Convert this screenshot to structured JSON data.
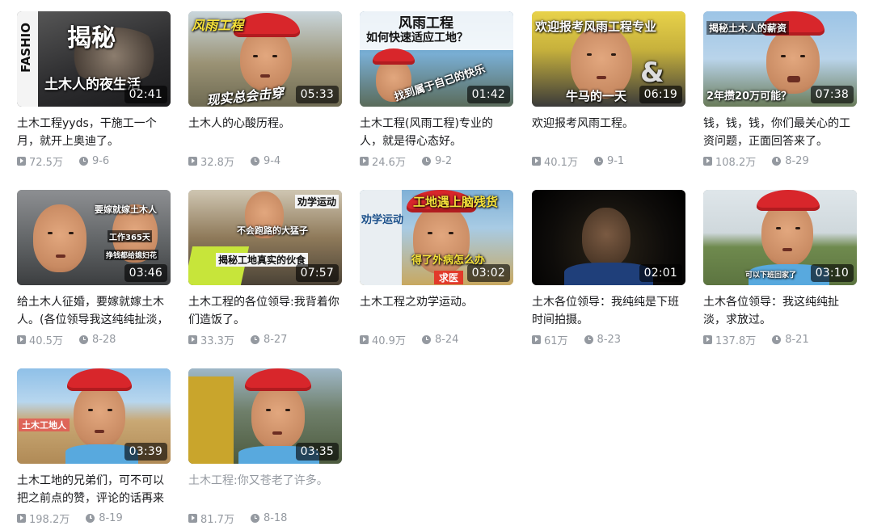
{
  "colors": {
    "text": "#18191c",
    "muted": "#9499a0",
    "duration_bg": "#000000"
  },
  "videos": [
    {
      "duration": "02:41",
      "title": "土木工程yyds，干施工一个月，就开上奥迪了。",
      "views": "72.5万",
      "date": "9-6",
      "overlay": [
        "揭秘",
        "土木人的夜生活",
        "FASHIO"
      ]
    },
    {
      "duration": "05:33",
      "title": "土木人的心酸历程。",
      "views": "32.8万",
      "date": "9-4",
      "overlay": [
        "风雨工程",
        "现实总会击穿"
      ]
    },
    {
      "duration": "01:42",
      "title": "土木工程(风雨工程)专业的人，就是得心态好。",
      "views": "24.6万",
      "date": "9-2",
      "overlay": [
        "风雨工程",
        "如何快速适应工地？",
        "找到属于自己的快乐"
      ]
    },
    {
      "duration": "06:19",
      "title": "欢迎报考风雨工程。",
      "views": "40.1万",
      "date": "9-1",
      "overlay": [
        "欢迎报考风雨工程专业",
        "牛马的一天",
        "&"
      ]
    },
    {
      "duration": "07:38",
      "title": "钱，钱，钱，你们最关心的工资问题，正面回答来了。",
      "views": "108.2万",
      "date": "8-29",
      "overlay": [
        "揭秘土木人的薪资",
        "2年攒20万可能？"
      ]
    },
    {
      "duration": "03:46",
      "title": "给土木人征婚，要嫁就嫁土木人。(各位领导我这纯纯扯淡，",
      "views": "40.5万",
      "date": "8-28",
      "overlay": [
        "要嫁就嫁土木人",
        "工作365天",
        "挣钱都给媳妇花"
      ]
    },
    {
      "duration": "07:57",
      "title": "土木工程的各位领导:我背着你们造饭了。",
      "views": "33.3万",
      "date": "8-27",
      "overlay": [
        "劝学运动",
        "不会跑路的大猛子",
        "揭秘工地真实的伙食"
      ]
    },
    {
      "duration": "03:02",
      "title": "土木工程之劝学运动。",
      "views": "40.9万",
      "date": "8-24",
      "overlay": [
        "工地遇上脑残货",
        "劝学运动",
        "得了外病怎么办",
        "求医"
      ]
    },
    {
      "duration": "02:01",
      "title": "土木各位领导：我纯纯是下班时间拍摄。",
      "views": "61万",
      "date": "8-23",
      "overlay": []
    },
    {
      "duration": "03:10",
      "title": "土木各位领导：我这纯纯扯淡，求放过。",
      "views": "137.8万",
      "date": "8-21",
      "overlay": [
        "可以下班回家了"
      ]
    },
    {
      "duration": "03:39",
      "title": "土木工地的兄弟们，可不可以把之前点的赞，评论的话再来",
      "views": "198.2万",
      "date": "8-19",
      "overlay": [
        "土木工地人"
      ]
    },
    {
      "duration": "03:35",
      "title": "土木工程:你又苍老了许多。",
      "views": "81.7万",
      "date": "8-18",
      "overlay": [],
      "title_muted": true
    }
  ]
}
